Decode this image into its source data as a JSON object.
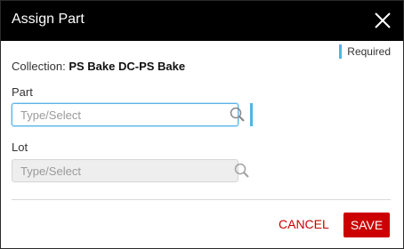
{
  "dialog": {
    "title": "Assign Part",
    "close_icon": "close-icon",
    "required_label": "Required"
  },
  "collection": {
    "label": "Collection:",
    "value": "PS Bake DC-PS Bake"
  },
  "part": {
    "label": "Part",
    "placeholder": "Type/Select",
    "value": "",
    "search_icon": "search-icon"
  },
  "lot": {
    "label": "Lot",
    "placeholder": "Type/Select",
    "value": "",
    "disabled": true,
    "search_icon": "search-icon"
  },
  "actions": {
    "cancel_label": "CANCEL",
    "save_label": "SAVE"
  },
  "colors": {
    "titlebar": "#000000",
    "accent": "#4db6e2",
    "action_red": "#cc0000"
  }
}
